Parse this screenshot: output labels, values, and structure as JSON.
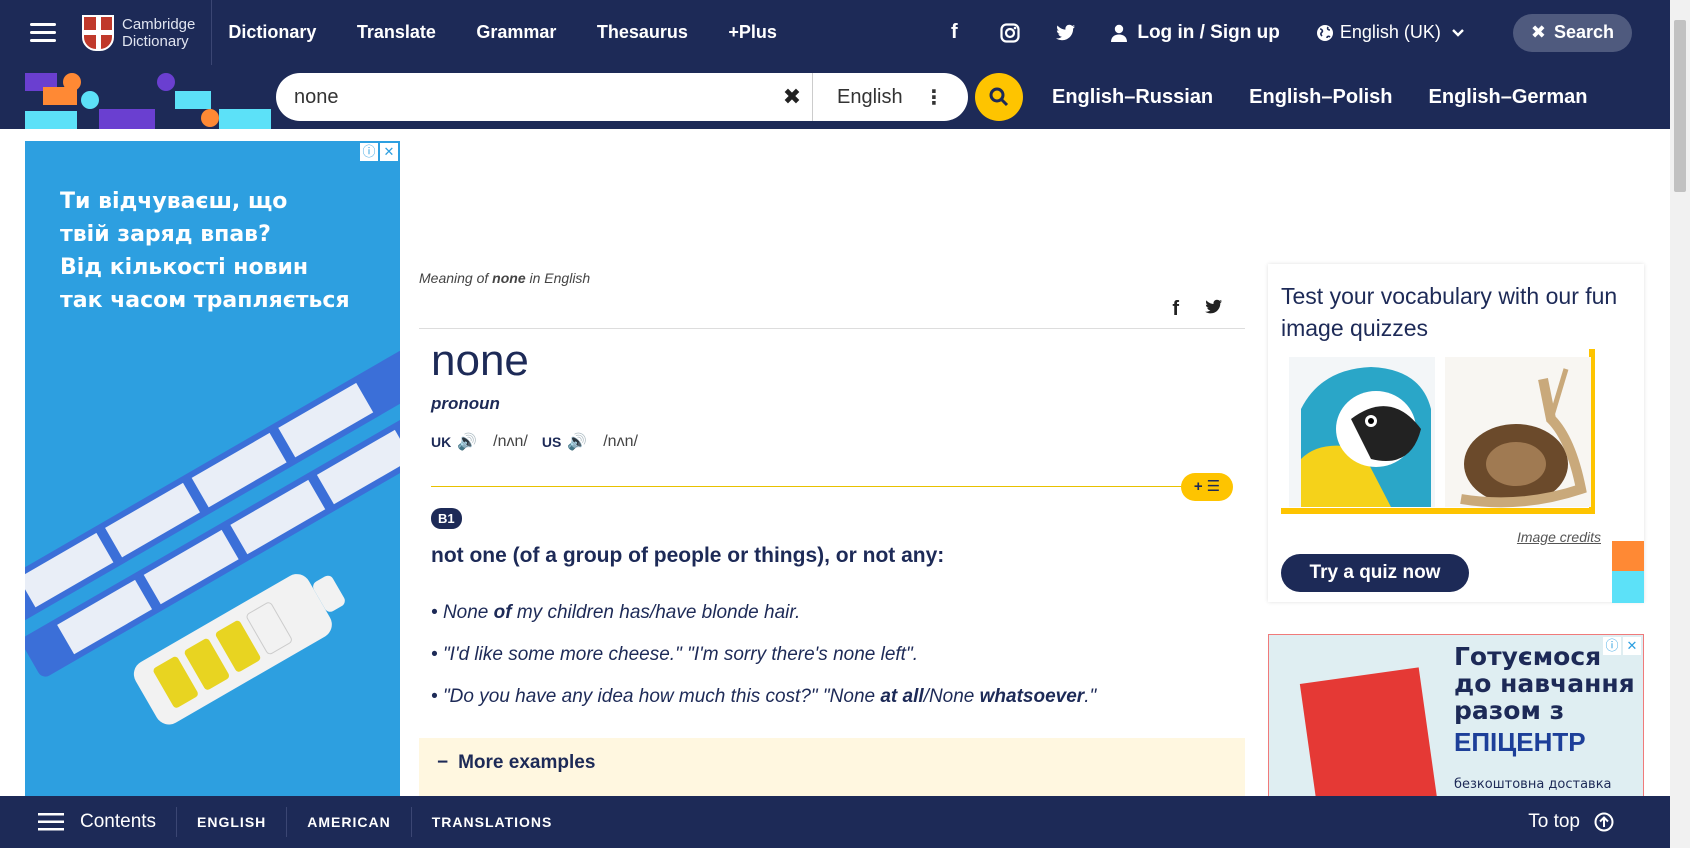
{
  "header": {
    "logo_line1": "Cambridge",
    "logo_line2": "Dictionary",
    "nav": [
      "Dictionary",
      "Translate",
      "Grammar",
      "Thesaurus",
      "+Plus"
    ],
    "login": "Log in / Sign up",
    "language": "English (UK)",
    "search_button": "Search"
  },
  "searchbar": {
    "query": "none",
    "dictionary": "English",
    "pairs": [
      "English–Russian",
      "English–Polish",
      "English–German"
    ]
  },
  "ad_left": {
    "text": [
      "Ти відчуваєш, що",
      "твій заряд впав?",
      "Від кількості новин",
      "так часом трапляється"
    ]
  },
  "entry": {
    "meaning_prefix": "Meaning of",
    "meaning_word": "none",
    "meaning_suffix": "in English",
    "headword": "none",
    "pos": "pronoun",
    "uk_label": "UK",
    "uk_ipa": "/nʌn/",
    "us_label": "US",
    "us_ipa": "/nʌn/",
    "pill": "+ ☰",
    "level": "B1",
    "definition": "not one (of a group of people or things), or not any:",
    "examples": [
      {
        "a": "None ",
        "b": "of",
        "c": " my children has/have blonde hair.",
        "d": "",
        "e": ""
      },
      {
        "a": "\"I'd like some more cheese.\" \"I'm sorry there's none left\".",
        "b": "",
        "c": "",
        "d": "",
        "e": ""
      },
      {
        "a": "\"Do you have any idea how much this cost?\" \"None ",
        "b": "at all",
        "c": "/None ",
        "d": "whatsoever",
        "e": ".\""
      }
    ],
    "more_examples": "More examples"
  },
  "quiz": {
    "title": "Test your vocabulary with our fun image quizzes",
    "credits": "Image credits",
    "button": "Try a quiz now"
  },
  "ad_right": {
    "title": [
      "Готуємося",
      "до навчання",
      "разом з"
    ],
    "brand": "ЕПІЦЕНТР",
    "sub": "безкоштовна доставка"
  },
  "bottom": {
    "contents": "Contents",
    "tabs": [
      "ENGLISH",
      "AMERICAN",
      "TRANSLATIONS"
    ],
    "to_top": "To top"
  }
}
